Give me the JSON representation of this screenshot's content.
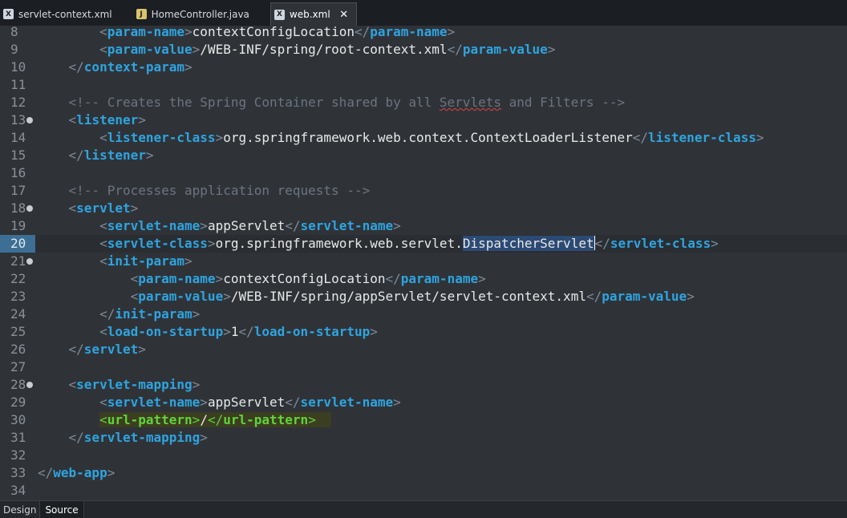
{
  "tabs": [
    {
      "label": "servlet-context.xml",
      "icon": "xml-file-icon"
    },
    {
      "label": "HomeController.java",
      "icon": "java-file-icon"
    },
    {
      "label": "web.xml",
      "icon": "xml-file-icon",
      "active": true
    }
  ],
  "editor": {
    "lines": [
      {
        "n": "8"
      },
      {
        "n": "9"
      },
      {
        "n": "10"
      },
      {
        "n": "11"
      },
      {
        "n": "12"
      },
      {
        "n": "13"
      },
      {
        "n": "14"
      },
      {
        "n": "15"
      },
      {
        "n": "16"
      },
      {
        "n": "17"
      },
      {
        "n": "18"
      },
      {
        "n": "19"
      },
      {
        "n": "20"
      },
      {
        "n": "21"
      },
      {
        "n": "22"
      },
      {
        "n": "23"
      },
      {
        "n": "24"
      },
      {
        "n": "25"
      },
      {
        "n": "26"
      },
      {
        "n": "27"
      },
      {
        "n": "28"
      },
      {
        "n": "29"
      },
      {
        "n": "30"
      },
      {
        "n": "31"
      },
      {
        "n": "32"
      },
      {
        "n": "33"
      },
      {
        "n": "34"
      }
    ],
    "text": {
      "t_param_name": "param-name",
      "t_param_value": "param-value",
      "t_context_param": "context-param",
      "t_listener": "listener",
      "t_listener_class": "listener-class",
      "t_servlet": "servlet",
      "t_servlet_name": "servlet-name",
      "t_servlet_class": "servlet-class",
      "t_init_param": "init-param",
      "t_load_on_startup": "load-on-startup",
      "t_servlet_mapping": "servlet-mapping",
      "t_url_pattern": "url-pattern",
      "t_web_app": "web-app",
      "v_context_config_location": "contextConfigLocation",
      "v_root_context": "/WEB-INF/spring/root-context.xml",
      "v_listener_class": "org.springframework.web.context.ContextLoaderListener",
      "v_app_servlet": "appServlet",
      "v_servlet_class_prefix": "org.springframework.web.servlet.",
      "v_servlet_class_selected": "DispatcherServlet",
      "v_servlet_context": "/WEB-INF/spring/appServlet/servlet-context.xml",
      "v_load_value": "1",
      "v_url_value": "/",
      "c_creates_pre": "<!-- Creates the Spring Container shared by all ",
      "c_creates_squig": "Servlets",
      "c_creates_post": " and Filters -->",
      "c_processes": "<!-- Processes application requests -->"
    }
  },
  "bottom_tabs": [
    {
      "label": "Design"
    },
    {
      "label": "Source",
      "active": true
    }
  ],
  "colors": {
    "background": "#2f3338",
    "tag": "#2fa4df",
    "comment": "#6c7480",
    "selection": "#2c4a73",
    "current_line_gutter": "#3d6f94",
    "match_highlight": "#61d33b"
  }
}
